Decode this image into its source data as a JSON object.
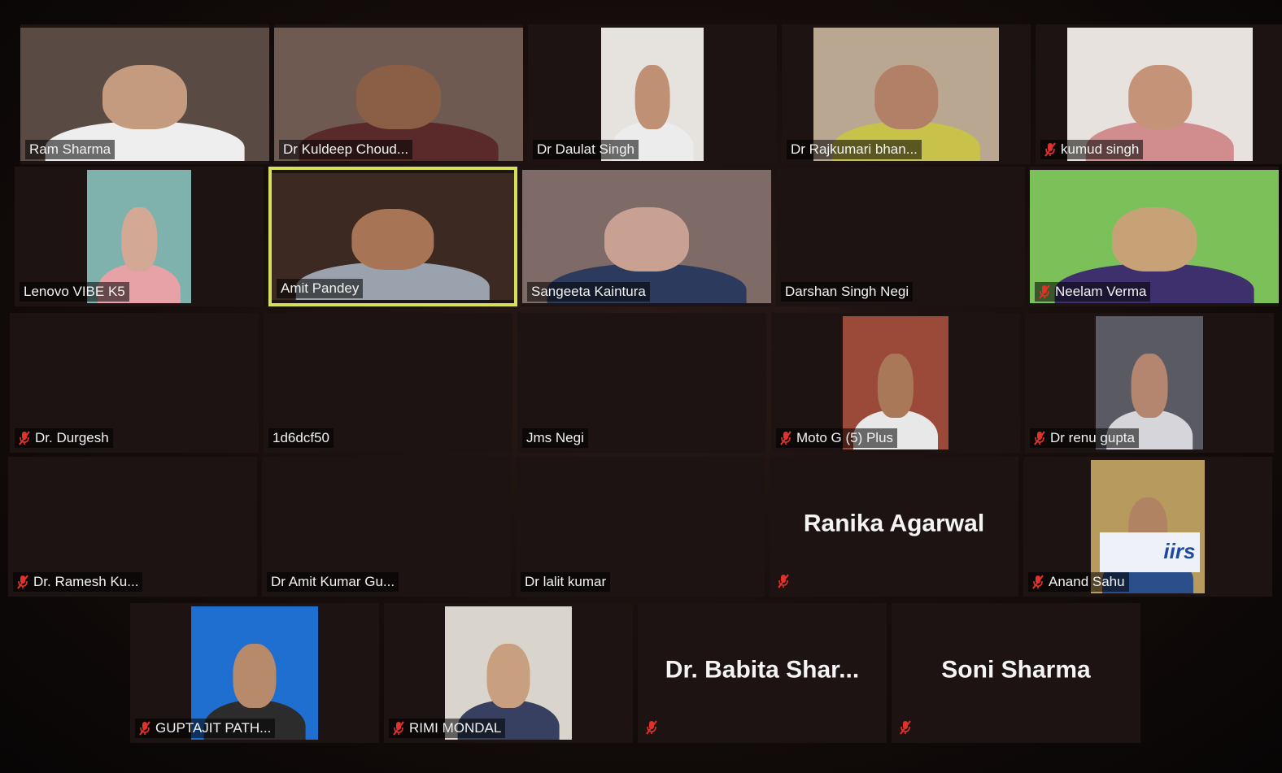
{
  "colors": {
    "active_border": "#d7e05a",
    "mute_red": "#e0322b",
    "label_text": "#f2f2f2"
  },
  "rows": [
    [
      {
        "name": "Ram Sharma",
        "muted": false,
        "video": true,
        "bg": "#5a4a44",
        "shirt": "#eeeeee",
        "skin": "#c59b80",
        "vw": 290,
        "full": true
      },
      {
        "name": "Dr Kuldeep Choud...",
        "muted": false,
        "video": true,
        "bg": "#6f5a52",
        "shirt": "#5a2a2a",
        "skin": "#8b5f45",
        "vw": 296,
        "full": true
      },
      {
        "name": "Dr Daulat Singh",
        "muted": false,
        "video": true,
        "bg": "#e6e2de",
        "shirt": "#ececec",
        "skin": "#c09075",
        "vw": 126
      },
      {
        "name": "Dr Rajkumari bhan...",
        "muted": false,
        "video": true,
        "bg": "#b9a791",
        "shirt": "#c8c24a",
        "skin": "#b28066",
        "vw": 228
      },
      {
        "name": "kumud singh",
        "muted": true,
        "video": true,
        "bg": "#e8e2de",
        "shirt": "#d18d8d",
        "skin": "#c59478",
        "vw": 228
      }
    ],
    [
      {
        "name": "Lenovo VIBE K5",
        "muted": false,
        "video": true,
        "bg": "#7fb2ad",
        "shirt": "#e6a2a6",
        "skin": "#d3a996",
        "vw": 128
      },
      {
        "name": "Amit Pandey",
        "muted": false,
        "video": true,
        "bg": "#3c2a22",
        "shirt": "#9aa3ad",
        "skin": "#a87456",
        "vw": 296,
        "full": true,
        "active": true
      },
      {
        "name": "Sangeeta Kaintura",
        "muted": false,
        "video": true,
        "bg": "#7e6a66",
        "shirt": "#2c3b5d",
        "skin": "#c9a193",
        "vw": 296,
        "full": true
      },
      {
        "name": "Darshan Singh Negi",
        "muted": false,
        "video": false
      },
      {
        "name": "Neelam Verma",
        "muted": true,
        "video": true,
        "bg": "#7cc05a",
        "shirt": "#3e2f6d",
        "skin": "#c7a276",
        "vw": 296,
        "full": true
      }
    ],
    [
      {
        "name": "Dr. Durgesh",
        "muted": true,
        "video": false
      },
      {
        "name": "1d6dcf50",
        "muted": false,
        "video": false
      },
      {
        "name": "Jms Negi",
        "muted": false,
        "video": false
      },
      {
        "name": "Moto G (5) Plus",
        "muted": true,
        "video": true,
        "bg": "#9b4a3a",
        "shirt": "#e8e8e8",
        "skin": "#a87858",
        "vw": 130
      },
      {
        "name": "Dr renu gupta",
        "muted": true,
        "video": true,
        "bg": "#5a5a62",
        "shirt": "#d6d6da",
        "skin": "#b48670",
        "vw": 132
      }
    ],
    [
      {
        "name": "Dr. Ramesh Ku...",
        "muted": true,
        "video": false
      },
      {
        "name": "Dr Amit Kumar Gu...",
        "muted": false,
        "video": false
      },
      {
        "name": "Dr lalit kumar",
        "muted": false,
        "video": false
      },
      {
        "center": "Ranika Agarwal",
        "muted": true,
        "video": false
      },
      {
        "name": "Anand Sahu",
        "muted": true,
        "video": true,
        "bg": "#b79a5e",
        "shirt": "#2a4f8a",
        "skin": "#b08463",
        "vw": 140,
        "banner": "iirs"
      }
    ],
    [
      {
        "name": "GUPTAJIT PATH...",
        "muted": true,
        "video": true,
        "bg": "#1f6fd0",
        "shirt": "#2c2c2c",
        "skin": "#b78a6b",
        "vw": 156
      },
      {
        "name": "RIMI MONDAL",
        "muted": true,
        "video": true,
        "bg": "#d9d5cc",
        "shirt": "#374060",
        "skin": "#c9a07f",
        "vw": 156
      },
      {
        "center": "Dr. Babita Shar...",
        "muted": true,
        "video": false
      },
      {
        "center": "Soni Sharma",
        "muted": true,
        "video": false
      }
    ]
  ]
}
